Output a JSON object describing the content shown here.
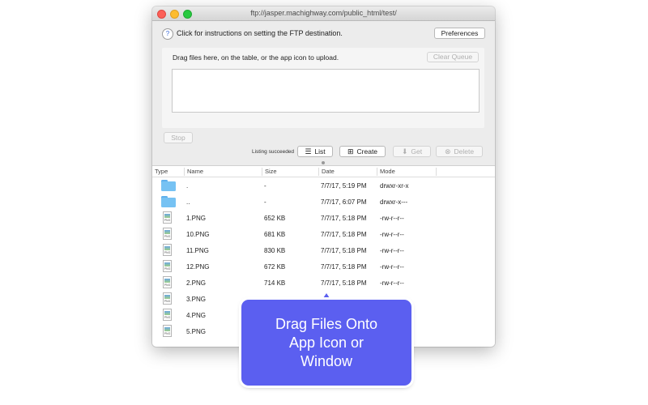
{
  "window": {
    "title": "ftp://jasper.machighway.com/public_html/test/"
  },
  "header": {
    "help_glyph": "?",
    "instructions": "Click  for instructions on setting the FTP destination.",
    "preferences_label": "Preferences"
  },
  "drop": {
    "instruction": "Drag files here, on the table, or the app icon to upload.",
    "clear_queue_label": "Clear Queue"
  },
  "controls": {
    "stop_label": "Stop",
    "status": "Listing succeeded",
    "list_label": "List",
    "create_label": "Create",
    "get_label": "Get",
    "delete_label": "Delete"
  },
  "table": {
    "columns": [
      "Type",
      "Name",
      "Size",
      "Date",
      "Mode"
    ],
    "rows": [
      {
        "type": "folder",
        "name": ".",
        "size": "-",
        "date": "7/7/17, 5:19 PM",
        "mode": "drwxr-xr-x"
      },
      {
        "type": "folder",
        "name": "..",
        "size": "-",
        "date": "7/7/17, 6:07 PM",
        "mode": "drwxr-x---"
      },
      {
        "type": "png",
        "name": "1.PNG",
        "size": "652 KB",
        "date": "7/7/17, 5:18 PM",
        "mode": "-rw-r--r--"
      },
      {
        "type": "png",
        "name": "10.PNG",
        "size": "681 KB",
        "date": "7/7/17, 5:18 PM",
        "mode": "-rw-r--r--"
      },
      {
        "type": "png",
        "name": "11.PNG",
        "size": "830 KB",
        "date": "7/7/17, 5:18 PM",
        "mode": "-rw-r--r--"
      },
      {
        "type": "png",
        "name": "12.PNG",
        "size": "672 KB",
        "date": "7/7/17, 5:18 PM",
        "mode": "-rw-r--r--"
      },
      {
        "type": "png",
        "name": "2.PNG",
        "size": "714 KB",
        "date": "7/7/17, 5:18 PM",
        "mode": "-rw-r--r--"
      },
      {
        "type": "png",
        "name": "3.PNG",
        "size": "",
        "date": "",
        "mode": ""
      },
      {
        "type": "png",
        "name": "4.PNG",
        "size": "",
        "date": "",
        "mode": ""
      },
      {
        "type": "png",
        "name": "5.PNG",
        "size": "",
        "date": "",
        "mode": ""
      }
    ],
    "png_icon_label": "PNG"
  },
  "callout": {
    "text_line1": "Drag Files Onto",
    "text_line2": "App Icon or",
    "text_line3": "Window"
  },
  "colors": {
    "callout": "#5b5ff0",
    "folder": "#76c2f3",
    "close": "#fc5f57",
    "minimize": "#fdbc2e",
    "zoom": "#28c940"
  },
  "icons": {
    "list": "list-icon",
    "create": "create-folder-icon",
    "get": "download-arrow-icon",
    "delete": "delete-x-icon",
    "help": "question-icon"
  }
}
